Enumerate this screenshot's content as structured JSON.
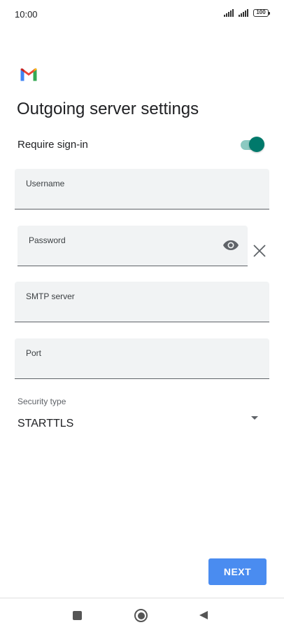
{
  "status_bar": {
    "time": "10:00",
    "battery": "100",
    "icons": [
      "signal-icon",
      "signal-icon",
      "battery-icon"
    ]
  },
  "app": {
    "logo": "gmail-logo",
    "title": "Outgoing server settings"
  },
  "require_signin": {
    "label": "Require sign-in",
    "enabled": true,
    "accent": "#00796b"
  },
  "fields": {
    "username": {
      "label": "Username",
      "value": ""
    },
    "password": {
      "label": "Password",
      "value": "",
      "show_icon": "eye-icon",
      "clear_icon": "close-icon"
    },
    "smtp_server": {
      "label": "SMTP server",
      "value": ""
    },
    "port": {
      "label": "Port",
      "value": ""
    }
  },
  "security": {
    "label": "Security type",
    "selected": "STARTTLS",
    "icon": "dropdown-arrow-icon"
  },
  "actions": {
    "next_label": "NEXT",
    "next_color": "#4a8cf0"
  },
  "nav_bar": {
    "icons": [
      "recents-icon",
      "home-icon",
      "back-icon"
    ]
  }
}
